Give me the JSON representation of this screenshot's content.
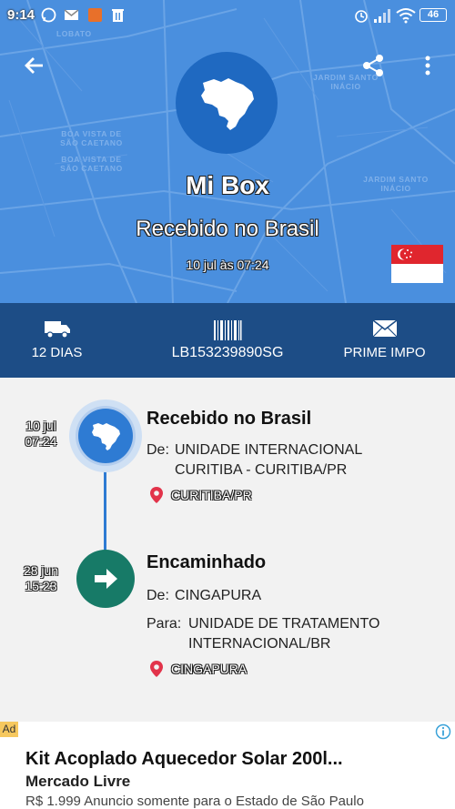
{
  "status_bar": {
    "time": "9:14",
    "battery": "46",
    "left_icons": [
      "whatsapp-icon",
      "gmail-icon",
      "app-icon",
      "trash-icon"
    ],
    "right_icons": [
      "alarm-icon",
      "signal-icon",
      "wifi-icon",
      "battery-icon"
    ]
  },
  "map_labels": [
    "LOBATO",
    "JARDIM SANTO INÁCIO",
    "BOA VISTA DE SÃO CAETANO",
    "BOA VISTA DE SÃO CAETANO",
    "JARDIM SANTO INÁCIO"
  ],
  "header": {
    "product_name": "Mi Box",
    "status": "Recebido no Brasil",
    "date": "10 jul às 07:24",
    "country_icon": "brazil-map-icon",
    "origin_flag": "singapore-flag"
  },
  "info_bar": {
    "days": "12 DIAS",
    "tracking_code": "LB153239890SG",
    "service": "PRIME IMPO"
  },
  "timeline": [
    {
      "date": "10 jul",
      "time": "07:24",
      "title": "Recebido no Brasil",
      "from_label": "De:",
      "from_line1": "UNIDADE INTERNACIONAL",
      "from_line2": "CURITIBA - CURITIBA/PR",
      "location": "CURITIBA/PR"
    },
    {
      "date": "28 jun",
      "time": "15:23",
      "title": "Encaminhado",
      "from_label": "De:",
      "from_line1": "CINGAPURA",
      "to_label": "Para:",
      "to_line1": "UNIDADE DE TRATAMENTO",
      "to_line2": "INTERNACIONAL/BR",
      "location": "CINGAPURA"
    }
  ],
  "ad": {
    "badge": "Ad",
    "title": "Kit Acoplado Aquecedor Solar 200l...",
    "advertiser": "Mercado Livre",
    "description": "R$ 1.999 Anuncio somente para o Estado de São Paulo"
  },
  "colors": {
    "header_bg": "#4a8fde",
    "circle": "#1f69c1",
    "info_bar": "#1d4d86",
    "timeline_line": "#2e7bd3",
    "node_forward": "#177a67",
    "pin": "#e2334a"
  }
}
